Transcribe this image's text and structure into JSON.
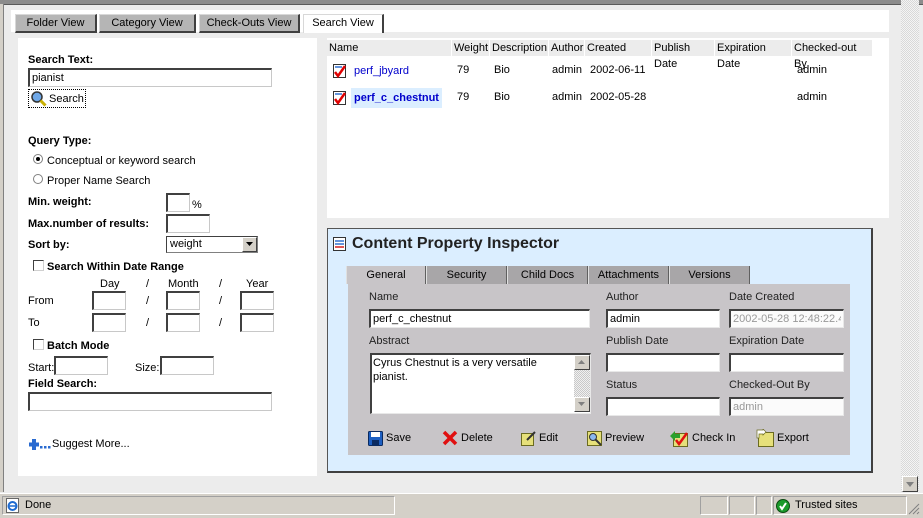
{
  "view_tabs": [
    {
      "label": "Folder View",
      "active": false
    },
    {
      "label": "Category View",
      "active": false
    },
    {
      "label": "Check-Outs View",
      "active": false
    },
    {
      "label": "Search View",
      "active": true
    }
  ],
  "search": {
    "search_text_label": "Search Text:",
    "search_text_value": "pianist",
    "search_button": "Search",
    "query_type_label": "Query Type:",
    "query_options": [
      {
        "label": "Conceptual or keyword search",
        "selected": true
      },
      {
        "label": "Proper Name Search",
        "selected": false
      }
    ],
    "min_weight_label": "Min. weight:",
    "min_weight_value": "",
    "percent_sign": "%",
    "max_results_label": "Max.number of results:",
    "max_results_value": "",
    "sort_by_label": "Sort by:",
    "sort_by_value": "weight",
    "date_range_label": "Search Within Date Range",
    "date_range_checked": false,
    "date_headers": {
      "day": "Day",
      "month": "Month",
      "year": "Year",
      "sep": "/"
    },
    "from_label": "From",
    "to_label": "To",
    "batch_mode_label": "Batch Mode",
    "batch_mode_checked": false,
    "start_label": "Start:",
    "size_label": "Size:",
    "field_search_label": "Field Search:",
    "field_search_value": "",
    "suggest_more": "Suggest More..."
  },
  "results": {
    "columns": [
      "Name",
      "Weight",
      "Description",
      "Author",
      "Created",
      "Publish Date",
      "Expiration Date",
      "Checked-out By"
    ],
    "rows": [
      {
        "name": "perf_jbyard",
        "weight": "79",
        "description": "Bio",
        "author": "admin",
        "created": "2002-06-11",
        "publish_date": "",
        "expiration_date": "",
        "checked_out_by": "admin",
        "selected": false
      },
      {
        "name": "perf_c_chestnut",
        "weight": "79",
        "description": "Bio",
        "author": "admin",
        "created": "2002-05-28",
        "publish_date": "",
        "expiration_date": "",
        "checked_out_by": "admin",
        "selected": true
      }
    ]
  },
  "inspector": {
    "title": "Content Property Inspector",
    "tabs": [
      {
        "label": "General",
        "active": true
      },
      {
        "label": "Security",
        "active": false
      },
      {
        "label": "Child Docs",
        "active": false
      },
      {
        "label": "Attachments",
        "active": false
      },
      {
        "label": "Versions",
        "active": false
      }
    ],
    "fields": {
      "name_label": "Name",
      "name_value": "perf_c_chestnut",
      "author_label": "Author",
      "author_value": "admin",
      "date_created_label": "Date Created",
      "date_created_value": "2002-05-28 12:48:22.4",
      "abstract_label": "Abstract",
      "abstract_value": "Cyrus Chestnut is a very versatile pianist.",
      "publish_date_label": "Publish Date",
      "publish_date_value": "",
      "expiration_date_label": "Expiration Date",
      "expiration_date_value": "",
      "status_label": "Status",
      "status_value": "",
      "checked_out_by_label": "Checked-Out By",
      "checked_out_by_value": "admin"
    },
    "actions": [
      "Save",
      "Delete",
      "Edit",
      "Preview",
      "Check In",
      "Export"
    ]
  },
  "statusbar": {
    "status_text": "Done",
    "zone_text": "Trusted sites"
  },
  "colors": {
    "link_blue": "#0000cc",
    "selected_row_bg": "#dbeeff",
    "inspector_bg": "#dbeeff",
    "inspector_panel": "#c8c5c8"
  }
}
